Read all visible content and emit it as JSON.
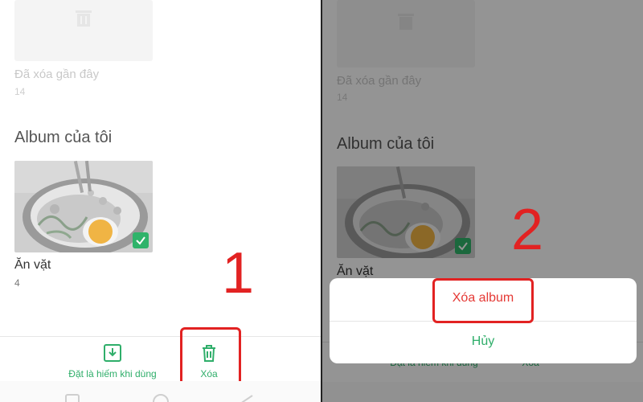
{
  "colors": {
    "accent_green": "#2fae6a",
    "highlight_red": "#e22222",
    "delete_red": "#e53935"
  },
  "left_panel": {
    "deleted_album": {
      "title": "Đã xóa gần đây",
      "count": "14",
      "icon": "trash-icon"
    },
    "section_title": "Album của tôi",
    "album": {
      "name": "Ăn vặt",
      "count": "4",
      "selected": true
    },
    "bottom_bar": {
      "save_label": "Đặt là hiếm khi dùng",
      "delete_label": "Xóa"
    },
    "step_number": "1"
  },
  "right_panel": {
    "deleted_album": {
      "title": "Đã xóa gần đây",
      "count": "14"
    },
    "section_title": "Album của tôi",
    "album": {
      "name": "Ăn vặt"
    },
    "bottom_bar": {
      "save_label": "Đặt là hiếm khi dùng",
      "delete_label": "Xóa"
    },
    "action_sheet": {
      "delete_album_label": "Xóa album",
      "cancel_label": "Hủy"
    },
    "step_number": "2"
  }
}
